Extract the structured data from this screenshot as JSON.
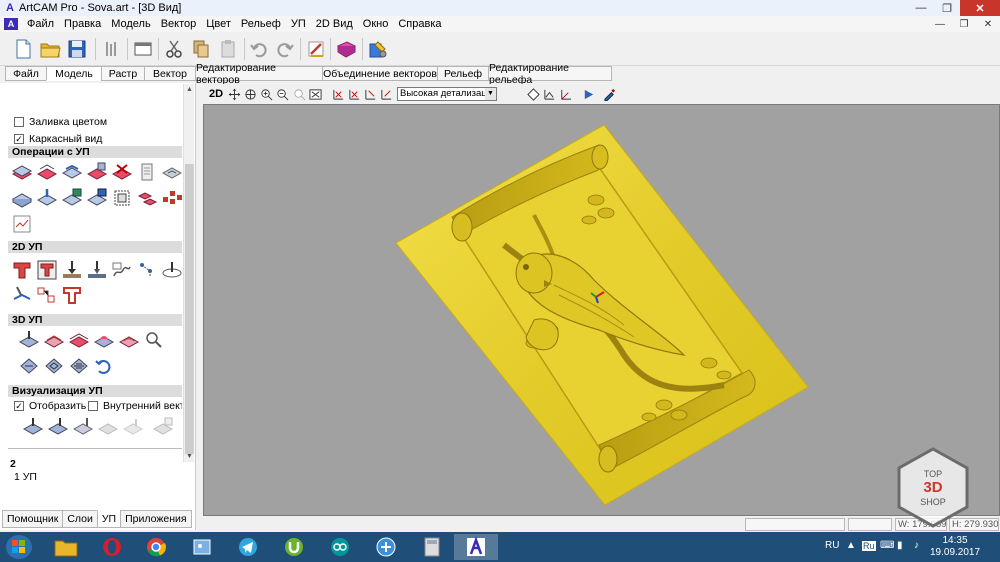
{
  "window": {
    "title": "ArtCAM Pro - Sova.art - [3D Вид]",
    "app_icon_letter": "A",
    "minimize": "—",
    "maximize": "❐",
    "close": "✕"
  },
  "menu": {
    "items": [
      "Файл",
      "Правка",
      "Модель",
      "Вектор",
      "Цвет",
      "Рельеф",
      "УП",
      "2D Вид",
      "Окно",
      "Справка"
    ],
    "mdi_minimize": "—",
    "mdi_restore": "❐",
    "mdi_close": "✕"
  },
  "toolbar": {
    "icons": [
      "new-file-icon",
      "open-folder-icon",
      "save-icon",
      "bitmap-icon",
      "window-icon",
      "cut-icon",
      "copy-icon",
      "paste-icon",
      "undo-icon",
      "redo-icon",
      "wizard-icon",
      "book-icon",
      "tools-icon"
    ]
  },
  "tabs": {
    "items": [
      "Файл",
      "Модель",
      "Растр",
      "Вектор",
      "Редактирование векторов",
      "Объединение векторов",
      "Рельеф",
      "Редактирование рельефа"
    ],
    "active": "Модель"
  },
  "left_panel": {
    "fill_color_label": "Заливка цветом",
    "fill_color_checked": false,
    "wireframe_label": "Каркасный вид",
    "wireframe_checked": true,
    "sections": {
      "toolpath_ops": "Операции с УП",
      "toolpath_2d": "2D УП",
      "toolpath_3d": "3D УП",
      "toolpath_vis": "Визуализация УП"
    },
    "show_label": "Отобразить",
    "show_checked": true,
    "inner_vector_label": "Внутренний векто",
    "inner_vector_checked": false,
    "count": "2",
    "toolpath_item": "1 УП",
    "check_mark": "✓"
  },
  "bottom_tabs": {
    "items": [
      "Помощник",
      "Слои",
      "УП",
      "Приложения"
    ],
    "active": "УП"
  },
  "view_toolbar": {
    "mode_2d": "2D",
    "detail_level": "Высокая детализация"
  },
  "status_bar": {
    "width": "W: 179.959",
    "height": "H: 279.930"
  },
  "watermark": {
    "line1": "TOP",
    "line2": "3D",
    "line3": "SHOP"
  },
  "taskbar": {
    "language": "RU",
    "time": "14:35",
    "date": "19.09.2017"
  },
  "colors": {
    "relief_gold": "#e8d22a",
    "viewport_bg": "#a1a1a1",
    "taskbar": "#1f4e79"
  }
}
